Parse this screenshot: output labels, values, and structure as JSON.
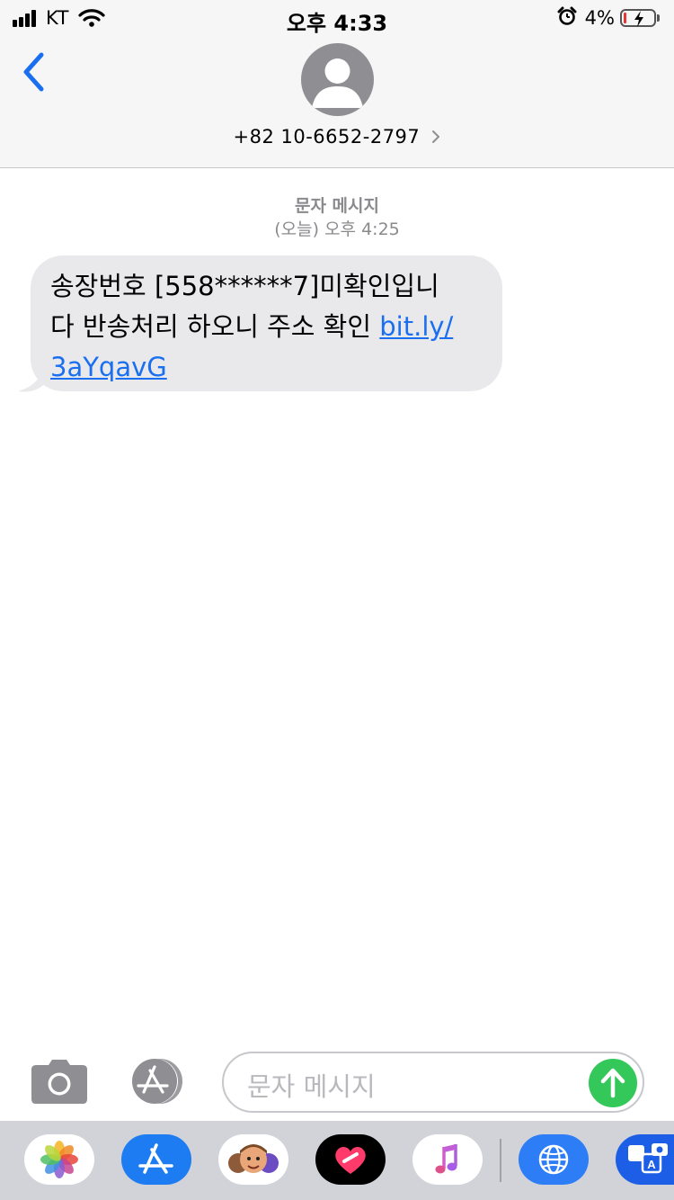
{
  "status_bar": {
    "carrier": "KT",
    "time": "오후 4:33",
    "battery_percent": "4%",
    "battery_level": 0.04,
    "icons": [
      "signal-icon",
      "wifi-icon",
      "alarm-icon",
      "battery-charging-icon"
    ]
  },
  "header": {
    "contact": "+82 10-6652-2797",
    "icons": [
      "back-chevron-icon",
      "avatar-icon",
      "chevron-right-icon"
    ]
  },
  "thread": {
    "message_type": "문자 메시지",
    "timestamp": "(오늘) 오후 4:25",
    "message": {
      "line1": "송장번호 [558******7]미확인입니",
      "line2_text": "다 반송처리 하오니 주소 확인 ",
      "link_part1": "bit.ly/",
      "link_part2": "3aYqavG"
    }
  },
  "input": {
    "placeholder": "문자 메시지",
    "icons": [
      "camera-icon",
      "app-store-icon",
      "send-arrow-icon"
    ]
  },
  "app_drawer": {
    "apps": [
      "photos-app-icon",
      "app-store-app-icon",
      "memoji-app-icon",
      "digital-touch-app-icon",
      "music-app-icon",
      "web-search-app-icon",
      "translate-app-icon"
    ]
  },
  "colors": {
    "accent": "#1a6ff0",
    "send": "#34c759",
    "bubble": "#e9e9eb",
    "header_bg": "#f6f6f6",
    "drawer_bg": "#d1d3d8"
  }
}
